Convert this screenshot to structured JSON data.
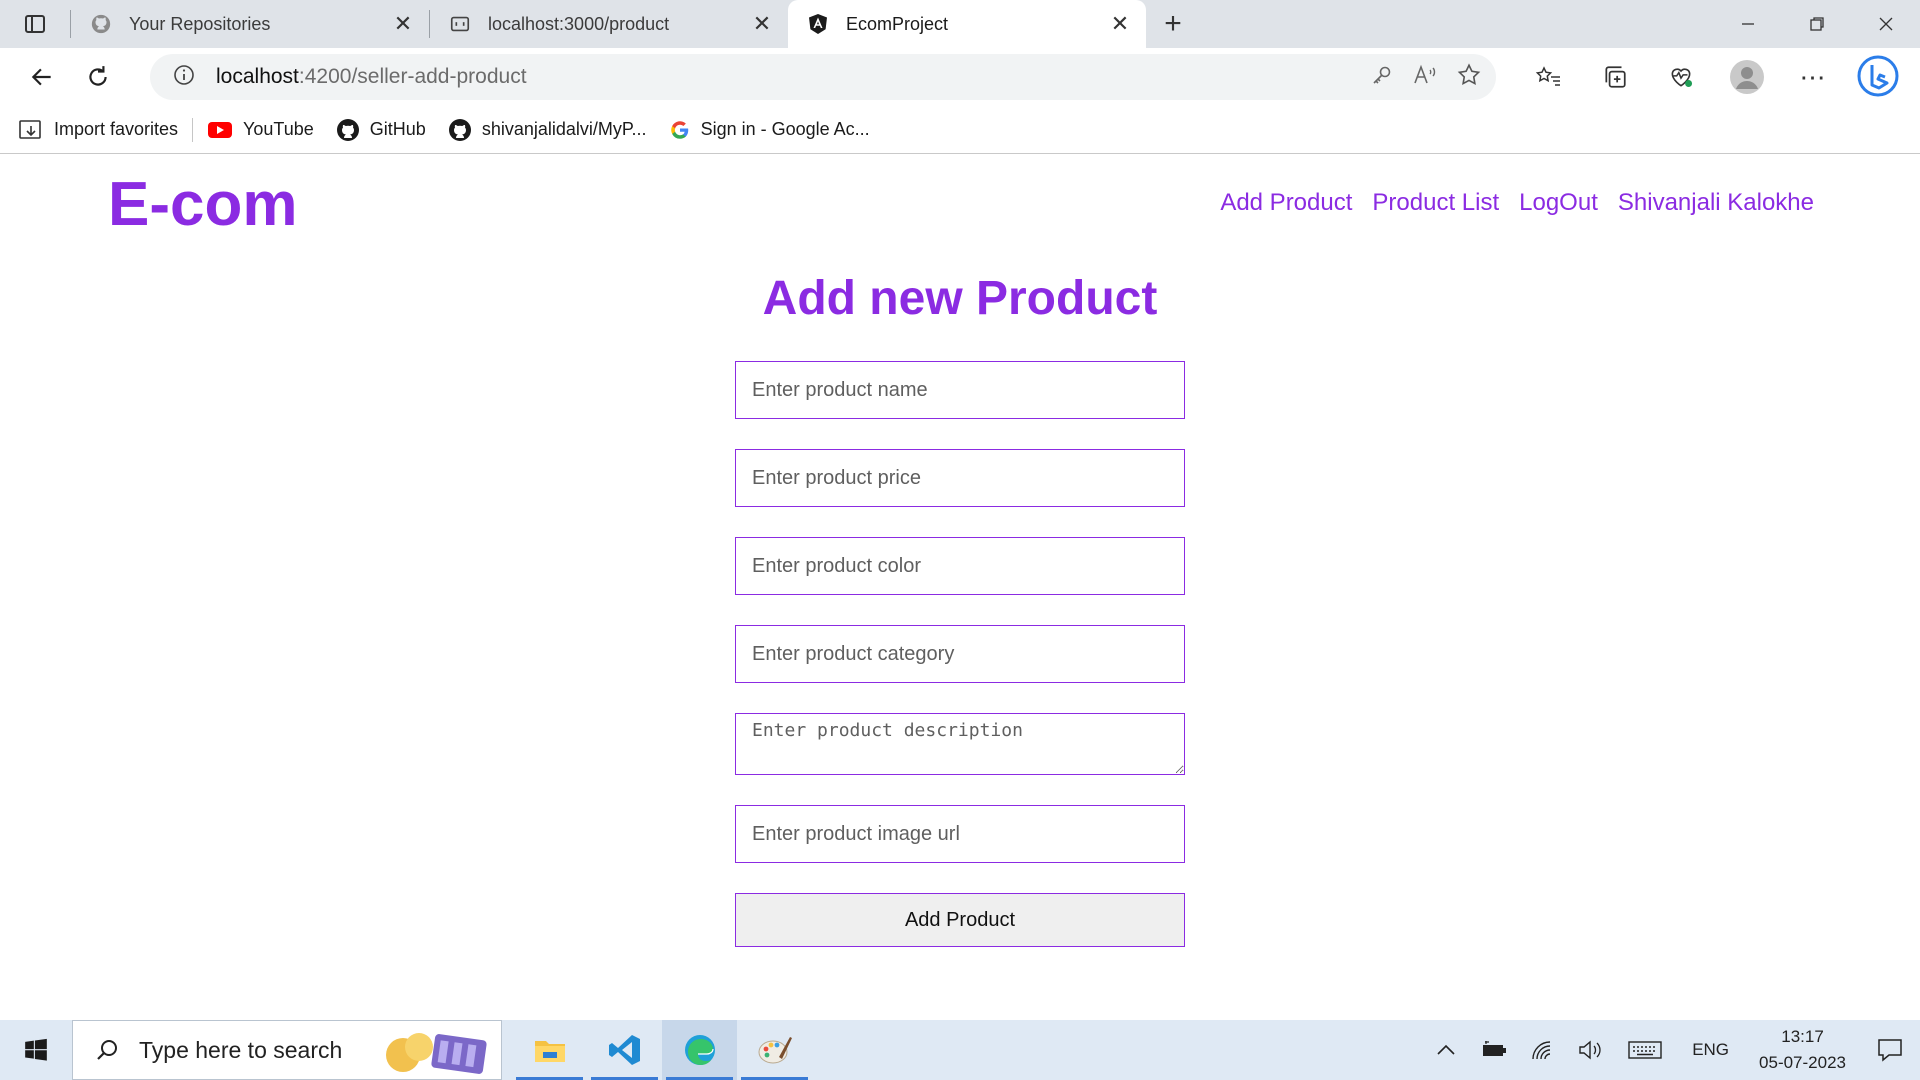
{
  "browser": {
    "tabs": [
      {
        "title": "Your Repositories",
        "icon": "github-icon",
        "active": false
      },
      {
        "title": "localhost:3000/product",
        "icon": "page-icon",
        "active": false
      },
      {
        "title": "EcomProject",
        "icon": "angular-icon",
        "active": true
      }
    ],
    "address": {
      "host": "localhost",
      "path": ":4200/seller-add-product"
    },
    "favorites": [
      {
        "label": "Import favorites",
        "icon": "import-icon"
      },
      {
        "label": "YouTube",
        "icon": "youtube-icon"
      },
      {
        "label": "GitHub",
        "icon": "github-icon"
      },
      {
        "label": "shivanjalidalvi/MyP...",
        "icon": "github-icon"
      },
      {
        "label": "Sign in - Google Ac...",
        "icon": "google-icon"
      }
    ]
  },
  "app": {
    "logo": "E-com",
    "nav": [
      "Add Product",
      "Product List",
      "LogOut",
      "Shivanjali Kalokhe"
    ],
    "form": {
      "title": "Add new Product",
      "placeholders": {
        "name": "Enter product name",
        "price": "Enter product price",
        "color": "Enter product color",
        "category": "Enter product category",
        "description": "Enter product description",
        "image": "Enter product image url"
      },
      "submit_label": "Add Product"
    }
  },
  "taskbar": {
    "search_placeholder": "Type here to search",
    "language": "ENG",
    "time": "13:17",
    "date": "05-07-2023"
  },
  "colors": {
    "accent": "#8b2be2",
    "taskbar": "#dfe9f4",
    "tabstrip": "#dfe3e8"
  }
}
